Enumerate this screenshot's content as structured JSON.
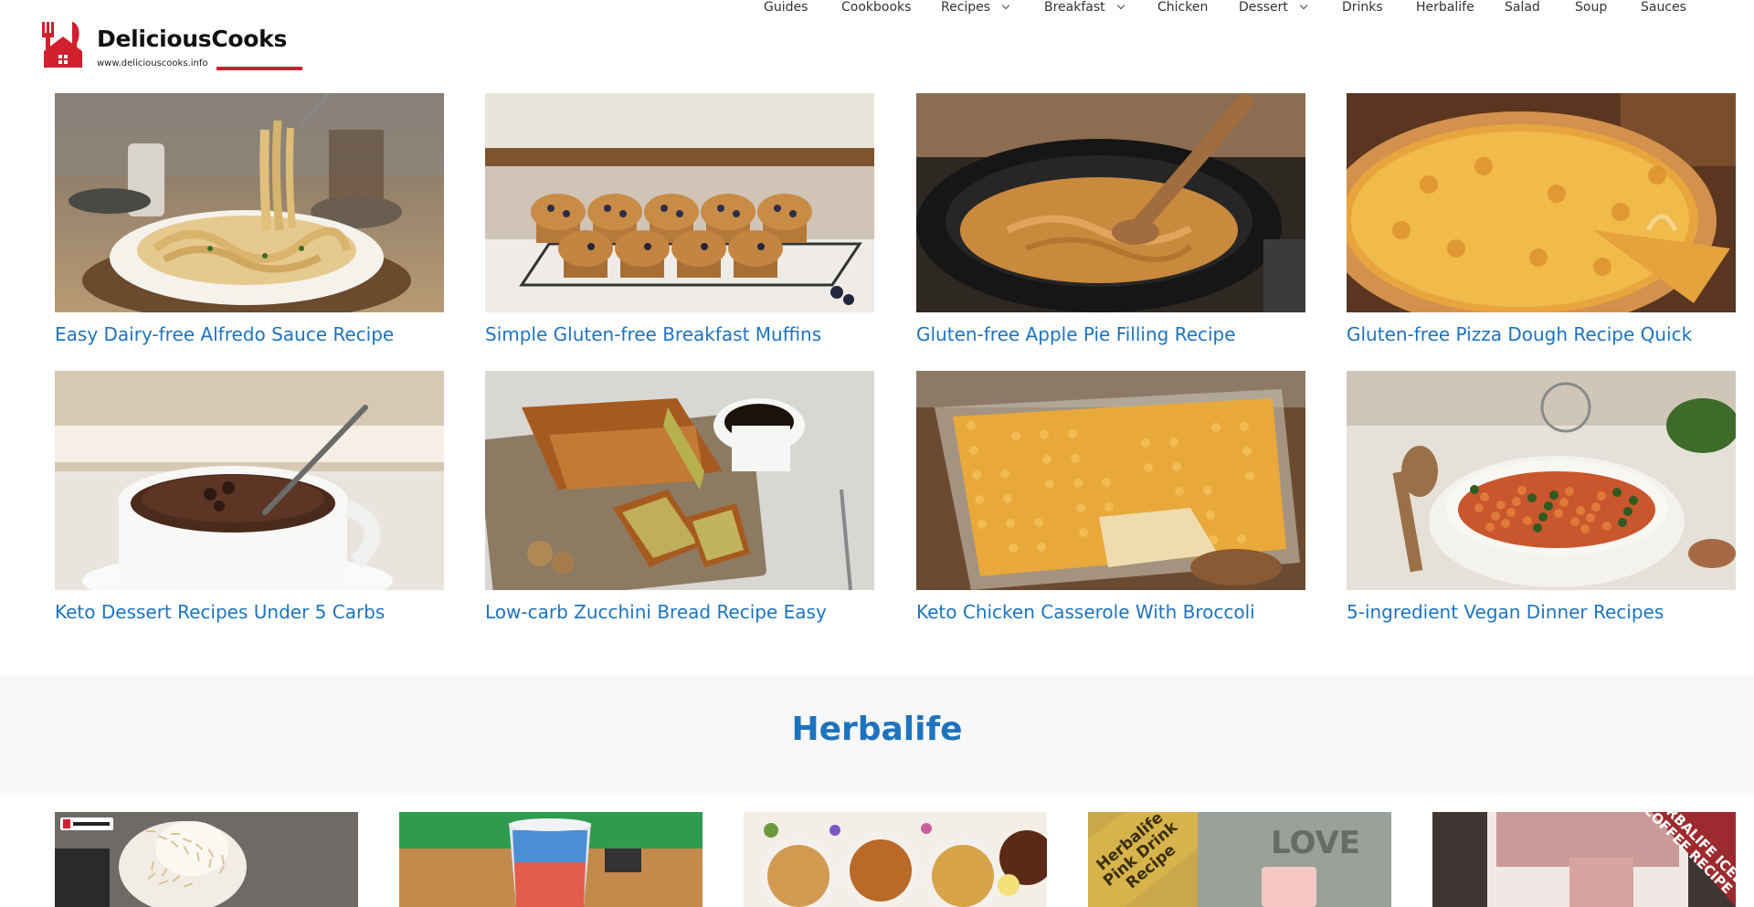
{
  "site": {
    "name": "DeliciousCooks",
    "url": "www.deliciouscooks.info",
    "brand_color": "#d0202e",
    "link_color": "#1e73be"
  },
  "nav": {
    "items": [
      {
        "label": "Guides",
        "dropdown": false
      },
      {
        "label": "Cookbooks",
        "dropdown": false
      },
      {
        "label": "Recipes",
        "dropdown": true
      },
      {
        "label": "Breakfast",
        "dropdown": true
      },
      {
        "label": "Chicken",
        "dropdown": false
      },
      {
        "label": "Dessert",
        "dropdown": true
      },
      {
        "label": "Drinks",
        "dropdown": false
      },
      {
        "label": "Herbalife",
        "dropdown": false
      },
      {
        "label": "Salad",
        "dropdown": false
      },
      {
        "label": "Soup",
        "dropdown": false
      },
      {
        "label": "Sauces",
        "dropdown": false
      }
    ]
  },
  "recipes": [
    {
      "title": "Easy Dairy-free Alfredo Sauce Recipe",
      "image": "alfredo-pasta"
    },
    {
      "title": "Simple Gluten-free Breakfast Muffins",
      "image": "blueberry-muffins"
    },
    {
      "title": "Gluten-free Apple Pie Filling Recipe",
      "image": "apple-pie-filling-pot"
    },
    {
      "title": "Gluten-free Pizza Dough Recipe Quick",
      "image": "cheese-pizza"
    },
    {
      "title": "Keto Dessert Recipes Under 5 Carbs",
      "image": "chocolate-mug-cake"
    },
    {
      "title": "Low-carb Zucchini Bread Recipe Easy",
      "image": "zucchini-bread"
    },
    {
      "title": "Keto Chicken Casserole With Broccoli",
      "image": "cheesy-casserole"
    },
    {
      "title": "5-ingredient Vegan Dinner Recipes",
      "image": "vegan-pasta-pot"
    }
  ],
  "section": {
    "title": "Herbalife"
  },
  "herbalife_thumbs": [
    {
      "image": "coconut-shake",
      "overlay_text": ""
    },
    {
      "image": "layered-tea-cup",
      "overlay_text": ""
    },
    {
      "image": "herbal-teas",
      "overlay_text": ""
    },
    {
      "image": "pink-drink",
      "overlay_text": "Herbalife Pink Drink Recipe",
      "shirt_text": "LOVE"
    },
    {
      "image": "iced-coffee",
      "overlay_text": "HERBALIFE ICED COFFEE RECIPE"
    }
  ]
}
